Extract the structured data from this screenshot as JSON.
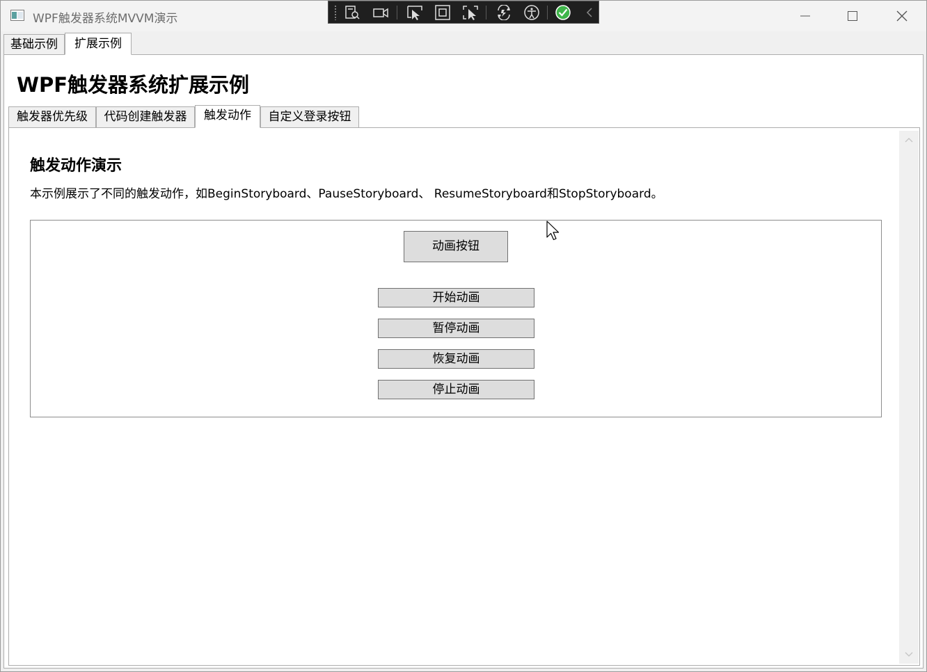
{
  "window": {
    "title": "WPF触发器系统MVVM演示"
  },
  "outer_tabs": [
    {
      "label": "基础示例",
      "selected": false
    },
    {
      "label": "扩展示例",
      "selected": true
    }
  ],
  "main": {
    "heading": "WPF触发器系统扩展示例",
    "inner_tabs": [
      {
        "label": "触发器优先级",
        "selected": false
      },
      {
        "label": "代码创建触发器",
        "selected": false
      },
      {
        "label": "触发动作",
        "selected": true
      },
      {
        "label": "自定义登录按钮",
        "selected": false
      }
    ],
    "section_title": "触发动作演示",
    "section_desc": "本示例展示了不同的触发动作，如BeginStoryboard、PauseStoryboard、 ResumeStoryboard和StopStoryboard。",
    "animated_button": "动画按钮",
    "controls": {
      "start": "开始动画",
      "pause": "暂停动画",
      "resume": "恢复动画",
      "stop": "停止动画"
    }
  },
  "debug_toolbar": {
    "icons": [
      "live-visual-tree-icon",
      "record-icon",
      "select-element-icon",
      "display-layout-adorners-icon",
      "track-focus-icon",
      "hot-reload-icon",
      "accessibility-icon",
      "binding-ok-icon",
      "collapse-icon"
    ],
    "status_color": "#3fb54a"
  },
  "colors": {
    "button_face": "#dddddd",
    "border": "#adadad",
    "toolbar_bg": "#1f1f1f"
  }
}
